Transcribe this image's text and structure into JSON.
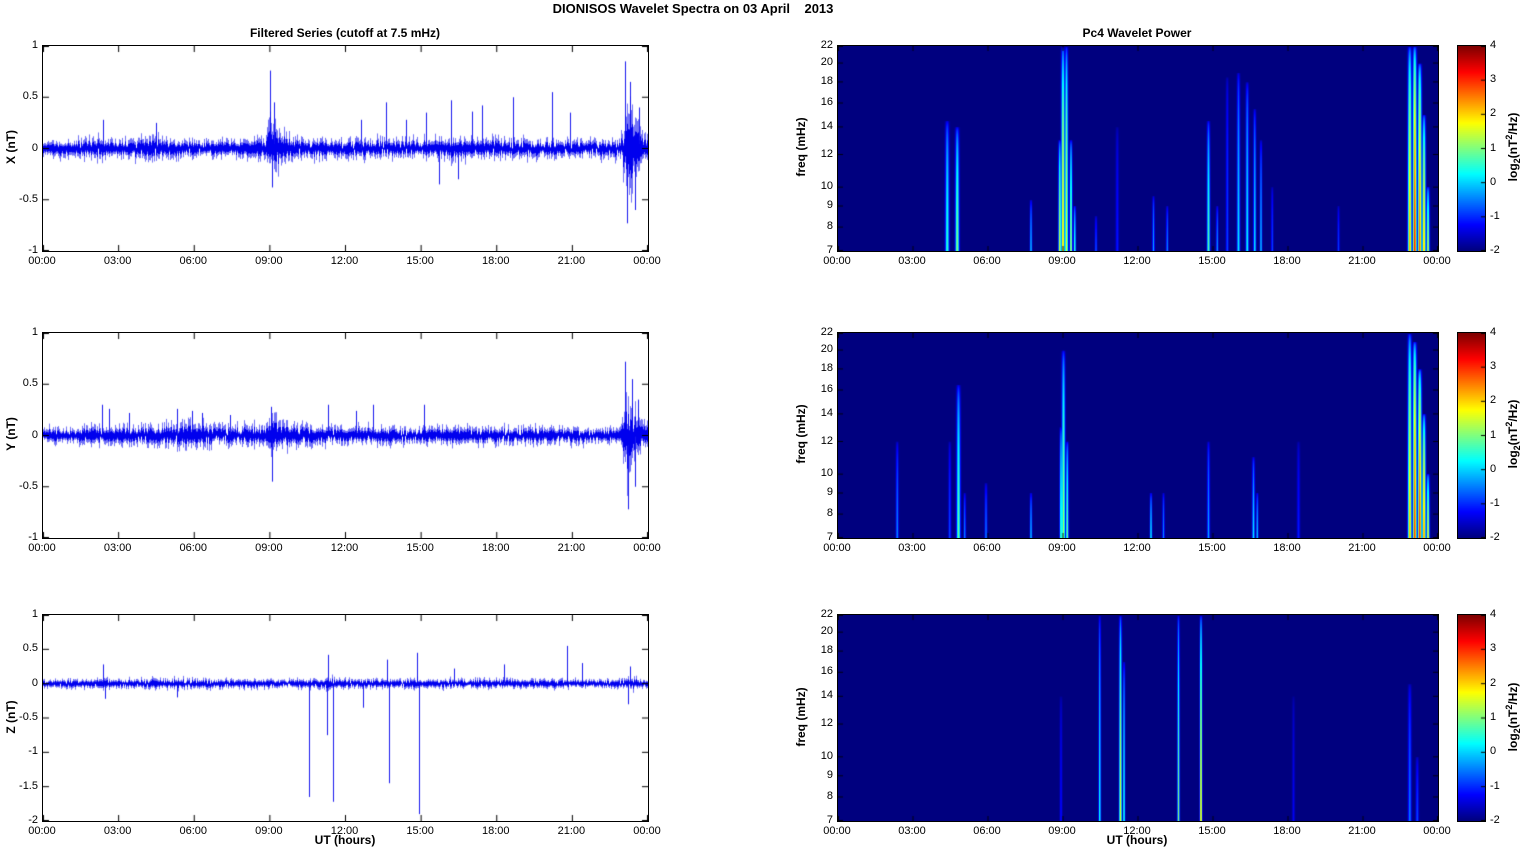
{
  "figure": {
    "title": "DIONISOS Wavelet Spectra on 03 April    2013"
  },
  "left_column": {
    "title": "Filtered Series (cutoff at 7.5 mHz)",
    "xlabel": "UT (hours)"
  },
  "right_column": {
    "title": "Pc4 Wavelet Power",
    "xlabel": "UT (hours)"
  },
  "time_axis": {
    "tick_labels": [
      "00:00",
      "03:00",
      "06:00",
      "09:00",
      "12:00",
      "15:00",
      "18:00",
      "21:00",
      "00:00"
    ],
    "tick_hours": [
      0,
      3,
      6,
      9,
      12,
      15,
      18,
      21,
      24
    ],
    "range_hours": [
      0,
      24
    ]
  },
  "colorbar": {
    "tick_labels": [
      "4",
      "3",
      "2",
      "1",
      "0",
      "-1",
      "-2"
    ],
    "tick_values": [
      4,
      3,
      2,
      1,
      0,
      -1,
      -2
    ],
    "range_log2_power": [
      -2,
      4
    ],
    "colormap": "jet",
    "label_parts": {
      "prefix": "log",
      "sub": "2",
      "mid": "(nT",
      "sup": "2",
      "suffix": "/Hz)"
    }
  },
  "chart_data": [
    {
      "type": "line",
      "name": "X filtered series",
      "ylabel": "X (nT)",
      "ylim": [
        -1,
        1
      ],
      "ytick_labels": [
        "1",
        "0.5",
        "0",
        "-0.5",
        "-1"
      ],
      "ytick_values": [
        1,
        0.5,
        0,
        -0.5,
        -1
      ],
      "color": "#0000ee",
      "noise_envelope": [
        [
          0,
          0.07
        ],
        [
          1,
          0.065
        ],
        [
          2.2,
          0.09
        ],
        [
          2.5,
          0.075
        ],
        [
          3,
          0.07
        ],
        [
          4.2,
          0.1
        ],
        [
          4.6,
          0.095
        ],
        [
          5.2,
          0.08
        ],
        [
          6,
          0.075
        ],
        [
          7,
          0.07
        ],
        [
          8,
          0.075
        ],
        [
          8.8,
          0.09
        ],
        [
          9.0,
          0.27
        ],
        [
          9.25,
          0.21
        ],
        [
          9.6,
          0.12
        ],
        [
          10,
          0.085
        ],
        [
          11,
          0.08
        ],
        [
          12,
          0.08
        ],
        [
          13,
          0.085
        ],
        [
          14,
          0.08
        ],
        [
          15,
          0.085
        ],
        [
          16,
          0.09
        ],
        [
          16.8,
          0.095
        ],
        [
          17.5,
          0.08
        ],
        [
          18.5,
          0.085
        ],
        [
          19.5,
          0.075
        ],
        [
          21,
          0.07
        ],
        [
          22.5,
          0.075
        ],
        [
          22.95,
          0.1
        ],
        [
          23.15,
          0.42
        ],
        [
          23.35,
          0.32
        ],
        [
          23.6,
          0.18
        ],
        [
          23.8,
          0.12
        ],
        [
          24,
          0.1
        ]
      ],
      "spikes": [
        [
          2.4,
          0.28
        ],
        [
          4.5,
          0.25
        ],
        [
          9.02,
          0.76
        ],
        [
          9.08,
          -0.38
        ],
        [
          9.15,
          0.45
        ],
        [
          12.6,
          0.28
        ],
        [
          13.6,
          0.45
        ],
        [
          14.4,
          0.28
        ],
        [
          15.2,
          0.35
        ],
        [
          15.7,
          -0.35
        ],
        [
          16.2,
          0.47
        ],
        [
          16.45,
          -0.3
        ],
        [
          17.0,
          0.36
        ],
        [
          17.4,
          0.42
        ],
        [
          18.65,
          0.5
        ],
        [
          20.2,
          0.55
        ],
        [
          20.9,
          0.35
        ],
        [
          23.1,
          0.85
        ],
        [
          23.18,
          -0.73
        ],
        [
          23.3,
          0.65
        ],
        [
          23.5,
          -0.6
        ],
        [
          23.65,
          0.4
        ]
      ]
    },
    {
      "type": "heatmap",
      "name": "X Pc4 wavelet power",
      "ylabel": "freq (mHz)",
      "freq_range_mhz": [
        7,
        22
      ],
      "freq_scale": "log",
      "ftick_labels": [
        "22",
        "20",
        "18",
        "16",
        "14",
        "12",
        "10",
        "9",
        "8",
        "7"
      ],
      "ftick_values": [
        22,
        20,
        18,
        16,
        14,
        12,
        10,
        9,
        8,
        7
      ],
      "zlim_log2": [
        -2,
        4
      ],
      "background_log2_power": -2,
      "events_format": "[time_h, freq_top_mHz, peak_log2_power, halfwidth_h]",
      "events": [
        [
          4.35,
          14.5,
          0.6,
          0.05
        ],
        [
          4.75,
          14,
          1.1,
          0.05
        ],
        [
          7.7,
          9.3,
          0.0,
          0.03
        ],
        [
          8.85,
          13,
          1.6,
          0.035
        ],
        [
          8.98,
          22,
          2.1,
          0.045
        ],
        [
          9.12,
          22,
          1.7,
          0.04
        ],
        [
          9.3,
          13,
          1.4,
          0.035
        ],
        [
          9.45,
          9,
          0.6,
          0.03
        ],
        [
          10.3,
          8.5,
          -0.7,
          0.03
        ],
        [
          11.15,
          14,
          -1.1,
          0.04
        ],
        [
          12.6,
          9.5,
          -0.2,
          0.03
        ],
        [
          13.15,
          9,
          -0.4,
          0.03
        ],
        [
          14.8,
          14.5,
          0.8,
          0.04
        ],
        [
          15.15,
          9,
          -0.3,
          0.03
        ],
        [
          15.55,
          18.5,
          -0.8,
          0.035
        ],
        [
          16.0,
          19,
          0.2,
          0.04
        ],
        [
          16.35,
          18,
          0.3,
          0.04
        ],
        [
          16.65,
          15.5,
          0.2,
          0.035
        ],
        [
          16.9,
          13,
          0.0,
          0.03
        ],
        [
          17.35,
          10,
          -0.8,
          0.03
        ],
        [
          20.0,
          9,
          -0.9,
          0.03
        ],
        [
          22.85,
          22,
          2.3,
          0.05
        ],
        [
          23.05,
          22,
          3.2,
          0.05
        ],
        [
          23.25,
          20,
          2.8,
          0.05
        ],
        [
          23.42,
          15,
          2.2,
          0.045
        ],
        [
          23.58,
          10,
          1.5,
          0.04
        ]
      ]
    },
    {
      "type": "line",
      "name": "Y filtered series",
      "ylabel": "Y (nT)",
      "ylim": [
        -1,
        1
      ],
      "ytick_labels": [
        "1",
        "0.5",
        "0",
        "-0.5",
        "-1"
      ],
      "ytick_values": [
        1,
        0.5,
        0,
        -0.5,
        -1
      ],
      "color": "#0000ee",
      "noise_envelope": [
        [
          0,
          0.065
        ],
        [
          1.5,
          0.07
        ],
        [
          2.3,
          0.085
        ],
        [
          3,
          0.075
        ],
        [
          4.5,
          0.09
        ],
        [
          5,
          0.1
        ],
        [
          5.5,
          0.105
        ],
        [
          6.2,
          0.1
        ],
        [
          7,
          0.09
        ],
        [
          8,
          0.08
        ],
        [
          8.85,
          0.085
        ],
        [
          9.05,
          0.17
        ],
        [
          9.3,
          0.14
        ],
        [
          9.7,
          0.1
        ],
        [
          10.5,
          0.08
        ],
        [
          12,
          0.075
        ],
        [
          14,
          0.07
        ],
        [
          16,
          0.07
        ],
        [
          18,
          0.07
        ],
        [
          20,
          0.07
        ],
        [
          22,
          0.065
        ],
        [
          22.9,
          0.08
        ],
        [
          23.15,
          0.35
        ],
        [
          23.4,
          0.28
        ],
        [
          23.65,
          0.15
        ],
        [
          24,
          0.11
        ]
      ],
      "spikes": [
        [
          2.35,
          0.3
        ],
        [
          2.6,
          0.26
        ],
        [
          3.4,
          0.22
        ],
        [
          5.3,
          0.26
        ],
        [
          5.9,
          0.24
        ],
        [
          6.3,
          0.22
        ],
        [
          7.4,
          0.2
        ],
        [
          9.05,
          0.28
        ],
        [
          9.1,
          -0.45
        ],
        [
          11.3,
          0.3
        ],
        [
          12.4,
          0.24
        ],
        [
          13.1,
          0.3
        ],
        [
          15.1,
          0.3
        ],
        [
          23.1,
          0.72
        ],
        [
          23.2,
          -0.72
        ],
        [
          23.35,
          0.55
        ],
        [
          23.5,
          -0.5
        ],
        [
          23.6,
          0.35
        ]
      ]
    },
    {
      "type": "heatmap",
      "name": "Y Pc4 wavelet power",
      "ylabel": "freq (mHz)",
      "freq_range_mhz": [
        7,
        22
      ],
      "freq_scale": "log",
      "ftick_labels": [
        "22",
        "20",
        "18",
        "16",
        "14",
        "12",
        "10",
        "9",
        "8",
        "7"
      ],
      "ftick_values": [
        22,
        20,
        18,
        16,
        14,
        12,
        10,
        9,
        8,
        7
      ],
      "zlim_log2": [
        -2,
        4
      ],
      "background_log2_power": -2,
      "events_format": "[time_h, freq_top_mHz, peak_log2_power, halfwidth_h]",
      "events": [
        [
          2.35,
          12,
          -0.4,
          0.035
        ],
        [
          4.45,
          12,
          -0.8,
          0.035
        ],
        [
          4.8,
          16.5,
          0.9,
          0.05
        ],
        [
          5.05,
          9,
          -0.4,
          0.03
        ],
        [
          5.9,
          9.5,
          -0.5,
          0.035
        ],
        [
          7.7,
          9,
          0.0,
          0.03
        ],
        [
          8.9,
          13,
          0.9,
          0.035
        ],
        [
          9.0,
          20,
          1.3,
          0.045
        ],
        [
          9.15,
          12,
          1.0,
          0.035
        ],
        [
          12.5,
          9,
          0.3,
          0.03
        ],
        [
          13.0,
          9,
          -0.4,
          0.03
        ],
        [
          14.8,
          12,
          -0.2,
          0.035
        ],
        [
          16.6,
          11,
          0.2,
          0.035
        ],
        [
          16.75,
          9,
          0.0,
          0.03
        ],
        [
          18.4,
          12,
          -1.1,
          0.04
        ],
        [
          22.85,
          22,
          2.2,
          0.05
        ],
        [
          23.05,
          21,
          3.0,
          0.05
        ],
        [
          23.25,
          18,
          3.1,
          0.05
        ],
        [
          23.42,
          14,
          2.5,
          0.045
        ],
        [
          23.58,
          10,
          1.7,
          0.04
        ]
      ]
    },
    {
      "type": "line",
      "name": "Z filtered series",
      "ylabel": "Z (nT)",
      "ylim": [
        -2,
        1
      ],
      "ytick_labels": [
        "1",
        "0.5",
        "0",
        "-0.5",
        "-1",
        "-1.5",
        "-2"
      ],
      "ytick_values": [
        1,
        0.5,
        0,
        -0.5,
        -1,
        -1.5,
        -2
      ],
      "color": "#0000ee",
      "noise_envelope": [
        [
          0,
          0.05
        ],
        [
          2,
          0.055
        ],
        [
          2.4,
          0.075
        ],
        [
          2.8,
          0.06
        ],
        [
          4,
          0.06
        ],
        [
          5.2,
          0.065
        ],
        [
          6,
          0.06
        ],
        [
          7,
          0.055
        ],
        [
          8,
          0.055
        ],
        [
          9,
          0.055
        ],
        [
          10,
          0.055
        ],
        [
          11,
          0.06
        ],
        [
          11.5,
          0.07
        ],
        [
          12,
          0.06
        ],
        [
          13,
          0.055
        ],
        [
          14,
          0.055
        ],
        [
          15,
          0.06
        ],
        [
          16,
          0.055
        ],
        [
          17,
          0.06
        ],
        [
          18,
          0.06
        ],
        [
          19,
          0.055
        ],
        [
          20,
          0.055
        ],
        [
          21,
          0.055
        ],
        [
          22,
          0.05
        ],
        [
          22.9,
          0.055
        ],
        [
          23.2,
          0.1
        ],
        [
          23.5,
          0.07
        ],
        [
          24,
          0.06
        ]
      ],
      "spikes": [
        [
          2.4,
          0.28
        ],
        [
          2.45,
          -0.22
        ],
        [
          5.3,
          -0.2
        ],
        [
          10.55,
          -1.65
        ],
        [
          11.25,
          -0.75
        ],
        [
          11.32,
          0.42
        ],
        [
          11.5,
          -1.72
        ],
        [
          12.7,
          -0.35
        ],
        [
          13.65,
          0.35
        ],
        [
          13.72,
          -1.45
        ],
        [
          14.85,
          0.45
        ],
        [
          14.92,
          -1.9
        ],
        [
          16.3,
          0.22
        ],
        [
          18.3,
          0.28
        ],
        [
          20.8,
          0.55
        ],
        [
          21.4,
          0.3
        ],
        [
          23.2,
          -0.3
        ],
        [
          23.3,
          0.25
        ]
      ]
    },
    {
      "type": "heatmap",
      "name": "Z Pc4 wavelet power",
      "ylabel": "freq (mHz)",
      "freq_range_mhz": [
        7,
        22
      ],
      "freq_scale": "log",
      "ftick_labels": [
        "22",
        "20",
        "18",
        "16",
        "14",
        "12",
        "10",
        "9",
        "8",
        "7"
      ],
      "ftick_values": [
        22,
        20,
        18,
        16,
        14,
        12,
        10,
        9,
        8,
        7
      ],
      "zlim_log2": [
        -2,
        4
      ],
      "background_log2_power": -2,
      "events_format": "[time_h, freq_top_mHz, peak_log2_power, halfwidth_h]",
      "events": [
        [
          8.9,
          14,
          -1.2,
          0.035
        ],
        [
          10.45,
          22,
          0.4,
          0.03
        ],
        [
          11.28,
          22,
          1.7,
          0.035
        ],
        [
          11.42,
          17,
          0.5,
          0.03
        ],
        [
          13.6,
          22,
          1.1,
          0.03
        ],
        [
          14.5,
          22,
          2.3,
          0.03
        ],
        [
          18.2,
          14,
          -1.3,
          0.035
        ],
        [
          22.85,
          15,
          -0.5,
          0.045
        ],
        [
          23.15,
          10,
          -0.8,
          0.04
        ]
      ]
    }
  ]
}
